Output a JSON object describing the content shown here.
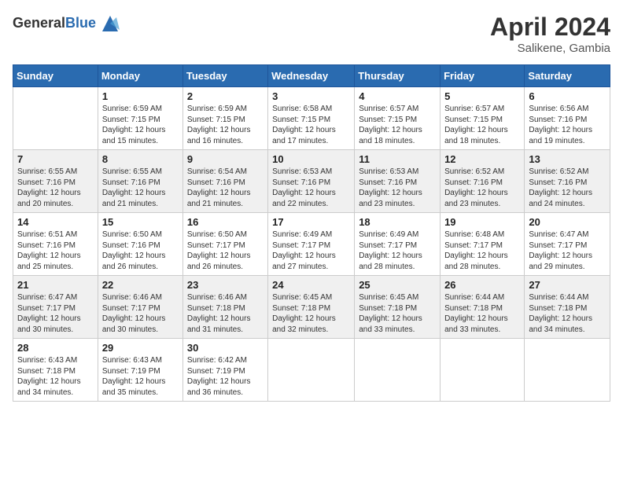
{
  "logo": {
    "general": "General",
    "blue": "Blue"
  },
  "header": {
    "month": "April 2024",
    "location": "Salikene, Gambia"
  },
  "weekdays": [
    "Sunday",
    "Monday",
    "Tuesday",
    "Wednesday",
    "Thursday",
    "Friday",
    "Saturday"
  ],
  "weeks": [
    [
      {
        "day": "",
        "info": ""
      },
      {
        "day": "1",
        "info": "Sunrise: 6:59 AM\nSunset: 7:15 PM\nDaylight: 12 hours\nand 15 minutes."
      },
      {
        "day": "2",
        "info": "Sunrise: 6:59 AM\nSunset: 7:15 PM\nDaylight: 12 hours\nand 16 minutes."
      },
      {
        "day": "3",
        "info": "Sunrise: 6:58 AM\nSunset: 7:15 PM\nDaylight: 12 hours\nand 17 minutes."
      },
      {
        "day": "4",
        "info": "Sunrise: 6:57 AM\nSunset: 7:15 PM\nDaylight: 12 hours\nand 18 minutes."
      },
      {
        "day": "5",
        "info": "Sunrise: 6:57 AM\nSunset: 7:15 PM\nDaylight: 12 hours\nand 18 minutes."
      },
      {
        "day": "6",
        "info": "Sunrise: 6:56 AM\nSunset: 7:16 PM\nDaylight: 12 hours\nand 19 minutes."
      }
    ],
    [
      {
        "day": "7",
        "info": "Sunrise: 6:55 AM\nSunset: 7:16 PM\nDaylight: 12 hours\nand 20 minutes."
      },
      {
        "day": "8",
        "info": "Sunrise: 6:55 AM\nSunset: 7:16 PM\nDaylight: 12 hours\nand 21 minutes."
      },
      {
        "day": "9",
        "info": "Sunrise: 6:54 AM\nSunset: 7:16 PM\nDaylight: 12 hours\nand 21 minutes."
      },
      {
        "day": "10",
        "info": "Sunrise: 6:53 AM\nSunset: 7:16 PM\nDaylight: 12 hours\nand 22 minutes."
      },
      {
        "day": "11",
        "info": "Sunrise: 6:53 AM\nSunset: 7:16 PM\nDaylight: 12 hours\nand 23 minutes."
      },
      {
        "day": "12",
        "info": "Sunrise: 6:52 AM\nSunset: 7:16 PM\nDaylight: 12 hours\nand 23 minutes."
      },
      {
        "day": "13",
        "info": "Sunrise: 6:52 AM\nSunset: 7:16 PM\nDaylight: 12 hours\nand 24 minutes."
      }
    ],
    [
      {
        "day": "14",
        "info": "Sunrise: 6:51 AM\nSunset: 7:16 PM\nDaylight: 12 hours\nand 25 minutes."
      },
      {
        "day": "15",
        "info": "Sunrise: 6:50 AM\nSunset: 7:16 PM\nDaylight: 12 hours\nand 26 minutes."
      },
      {
        "day": "16",
        "info": "Sunrise: 6:50 AM\nSunset: 7:17 PM\nDaylight: 12 hours\nand 26 minutes."
      },
      {
        "day": "17",
        "info": "Sunrise: 6:49 AM\nSunset: 7:17 PM\nDaylight: 12 hours\nand 27 minutes."
      },
      {
        "day": "18",
        "info": "Sunrise: 6:49 AM\nSunset: 7:17 PM\nDaylight: 12 hours\nand 28 minutes."
      },
      {
        "day": "19",
        "info": "Sunrise: 6:48 AM\nSunset: 7:17 PM\nDaylight: 12 hours\nand 28 minutes."
      },
      {
        "day": "20",
        "info": "Sunrise: 6:47 AM\nSunset: 7:17 PM\nDaylight: 12 hours\nand 29 minutes."
      }
    ],
    [
      {
        "day": "21",
        "info": "Sunrise: 6:47 AM\nSunset: 7:17 PM\nDaylight: 12 hours\nand 30 minutes."
      },
      {
        "day": "22",
        "info": "Sunrise: 6:46 AM\nSunset: 7:17 PM\nDaylight: 12 hours\nand 30 minutes."
      },
      {
        "day": "23",
        "info": "Sunrise: 6:46 AM\nSunset: 7:18 PM\nDaylight: 12 hours\nand 31 minutes."
      },
      {
        "day": "24",
        "info": "Sunrise: 6:45 AM\nSunset: 7:18 PM\nDaylight: 12 hours\nand 32 minutes."
      },
      {
        "day": "25",
        "info": "Sunrise: 6:45 AM\nSunset: 7:18 PM\nDaylight: 12 hours\nand 33 minutes."
      },
      {
        "day": "26",
        "info": "Sunrise: 6:44 AM\nSunset: 7:18 PM\nDaylight: 12 hours\nand 33 minutes."
      },
      {
        "day": "27",
        "info": "Sunrise: 6:44 AM\nSunset: 7:18 PM\nDaylight: 12 hours\nand 34 minutes."
      }
    ],
    [
      {
        "day": "28",
        "info": "Sunrise: 6:43 AM\nSunset: 7:18 PM\nDaylight: 12 hours\nand 34 minutes."
      },
      {
        "day": "29",
        "info": "Sunrise: 6:43 AM\nSunset: 7:19 PM\nDaylight: 12 hours\nand 35 minutes."
      },
      {
        "day": "30",
        "info": "Sunrise: 6:42 AM\nSunset: 7:19 PM\nDaylight: 12 hours\nand 36 minutes."
      },
      {
        "day": "",
        "info": ""
      },
      {
        "day": "",
        "info": ""
      },
      {
        "day": "",
        "info": ""
      },
      {
        "day": "",
        "info": ""
      }
    ]
  ]
}
